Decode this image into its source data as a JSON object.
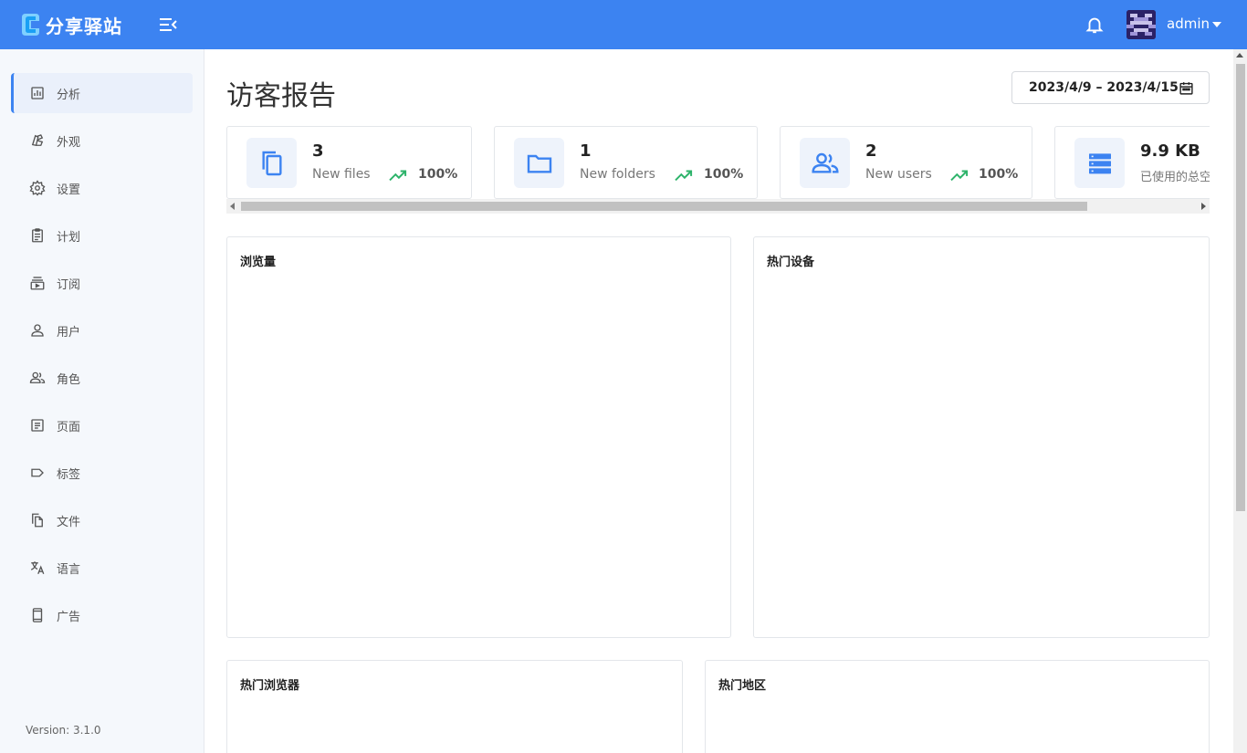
{
  "header": {
    "app_name": "分享驿站",
    "username": "admin",
    "colors": {
      "primary": "#3c83f1"
    }
  },
  "sidebar": {
    "items": [
      {
        "label": "分析",
        "icon": "chart-icon",
        "active": true
      },
      {
        "label": "外观",
        "icon": "palette-icon"
      },
      {
        "label": "设置",
        "icon": "gear-icon"
      },
      {
        "label": "计划",
        "icon": "clipboard-icon"
      },
      {
        "label": "订阅",
        "icon": "subscription-icon"
      },
      {
        "label": "用户",
        "icon": "user-icon"
      },
      {
        "label": "角色",
        "icon": "users-icon"
      },
      {
        "label": "页面",
        "icon": "page-icon"
      },
      {
        "label": "标签",
        "icon": "tag-icon"
      },
      {
        "label": "文件",
        "icon": "files-icon"
      },
      {
        "label": "语言",
        "icon": "translate-icon"
      },
      {
        "label": "广告",
        "icon": "phone-icon"
      }
    ],
    "version": "Version: 3.1.0"
  },
  "main": {
    "title": "访客报告",
    "date_range": "2023/4/9 – 2023/4/15",
    "stats": [
      {
        "value": "3",
        "label": "New files",
        "trend": "100%",
        "icon": "copy-icon"
      },
      {
        "value": "1",
        "label": "New folders",
        "trend": "100%",
        "icon": "folder-icon"
      },
      {
        "value": "2",
        "label": "New users",
        "trend": "100%",
        "icon": "users-icon"
      },
      {
        "value": "9.9 KB",
        "label": "已使用的总空间",
        "icon": "storage-icon"
      }
    ],
    "panels": {
      "views": "浏览量",
      "devices": "热门设备",
      "browsers": "热门浏览器",
      "regions": "热门地区"
    }
  }
}
